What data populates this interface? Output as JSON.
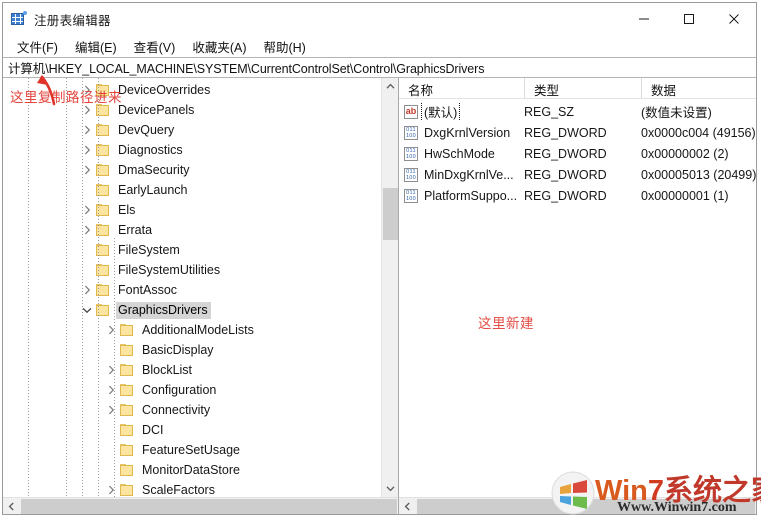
{
  "window": {
    "title": "注册表编辑器",
    "icon": "registry-editor-icon",
    "controls": {
      "minimize": "—",
      "maximize": "□",
      "close": "×"
    }
  },
  "menu": {
    "items": [
      {
        "label": "文件(F)",
        "name": "menu-file"
      },
      {
        "label": "编辑(E)",
        "name": "menu-edit"
      },
      {
        "label": "查看(V)",
        "name": "menu-view"
      },
      {
        "label": "收藏夹(A)",
        "name": "menu-favorites"
      },
      {
        "label": "帮助(H)",
        "name": "menu-help"
      }
    ]
  },
  "address": {
    "path": "计算机\\HKEY_LOCAL_MACHINE\\SYSTEM\\CurrentControlSet\\Control\\GraphicsDrivers"
  },
  "tree": {
    "nodes": [
      {
        "label": "DeviceOverrides",
        "depth": 1,
        "twisty": "collapsed",
        "selected": false
      },
      {
        "label": "DevicePanels",
        "depth": 1,
        "twisty": "collapsed",
        "selected": false
      },
      {
        "label": "DevQuery",
        "depth": 1,
        "twisty": "collapsed",
        "selected": false
      },
      {
        "label": "Diagnostics",
        "depth": 1,
        "twisty": "collapsed",
        "selected": false
      },
      {
        "label": "DmaSecurity",
        "depth": 1,
        "twisty": "collapsed",
        "selected": false
      },
      {
        "label": "EarlyLaunch",
        "depth": 1,
        "twisty": "none",
        "selected": false
      },
      {
        "label": "Els",
        "depth": 1,
        "twisty": "collapsed",
        "selected": false
      },
      {
        "label": "Errata",
        "depth": 1,
        "twisty": "collapsed",
        "selected": false
      },
      {
        "label": "FileSystem",
        "depth": 1,
        "twisty": "none",
        "selected": false
      },
      {
        "label": "FileSystemUtilities",
        "depth": 1,
        "twisty": "none",
        "selected": false
      },
      {
        "label": "FontAssoc",
        "depth": 1,
        "twisty": "collapsed",
        "selected": false
      },
      {
        "label": "GraphicsDrivers",
        "depth": 1,
        "twisty": "expanded",
        "selected": true
      },
      {
        "label": "AdditionalModeLists",
        "depth": 2,
        "twisty": "collapsed",
        "selected": false
      },
      {
        "label": "BasicDisplay",
        "depth": 2,
        "twisty": "none",
        "selected": false
      },
      {
        "label": "BlockList",
        "depth": 2,
        "twisty": "collapsed",
        "selected": false
      },
      {
        "label": "Configuration",
        "depth": 2,
        "twisty": "collapsed",
        "selected": false
      },
      {
        "label": "Connectivity",
        "depth": 2,
        "twisty": "collapsed",
        "selected": false
      },
      {
        "label": "DCI",
        "depth": 2,
        "twisty": "none",
        "selected": false
      },
      {
        "label": "FeatureSetUsage",
        "depth": 2,
        "twisty": "none",
        "selected": false
      },
      {
        "label": "MonitorDataStore",
        "depth": 2,
        "twisty": "none",
        "selected": false
      },
      {
        "label": "ScaleFactors",
        "depth": 2,
        "twisty": "collapsed",
        "selected": false
      }
    ]
  },
  "values": {
    "columns": {
      "name": "名称",
      "type": "类型",
      "data": "数据"
    },
    "rows": [
      {
        "name": "(默认)",
        "type": "REG_SZ",
        "data": "(数值未设置)",
        "icon": "string-value-icon",
        "focused": true
      },
      {
        "name": "DxgKrnlVersion",
        "type": "REG_DWORD",
        "data": "0x0000c004 (49156)",
        "icon": "dword-value-icon",
        "focused": false
      },
      {
        "name": "HwSchMode",
        "type": "REG_DWORD",
        "data": "0x00000002 (2)",
        "icon": "dword-value-icon",
        "focused": false
      },
      {
        "name": "MinDxgKrnlVe...",
        "type": "REG_DWORD",
        "data": "0x00005013 (20499)",
        "icon": "dword-value-icon",
        "focused": false
      },
      {
        "name": "PlatformSuppo...",
        "type": "REG_DWORD",
        "data": "0x00000001 (1)",
        "icon": "dword-value-icon",
        "focused": false
      }
    ]
  },
  "annotations": {
    "copy_path": "这里复制路径进来",
    "new_here": "这里新建",
    "color": "#e0342b"
  },
  "watermark": {
    "brand_prefix": "Win",
    "brand_seven": "7",
    "brand_cn": "系统之家",
    "url": "Www.Winwin7.com"
  }
}
